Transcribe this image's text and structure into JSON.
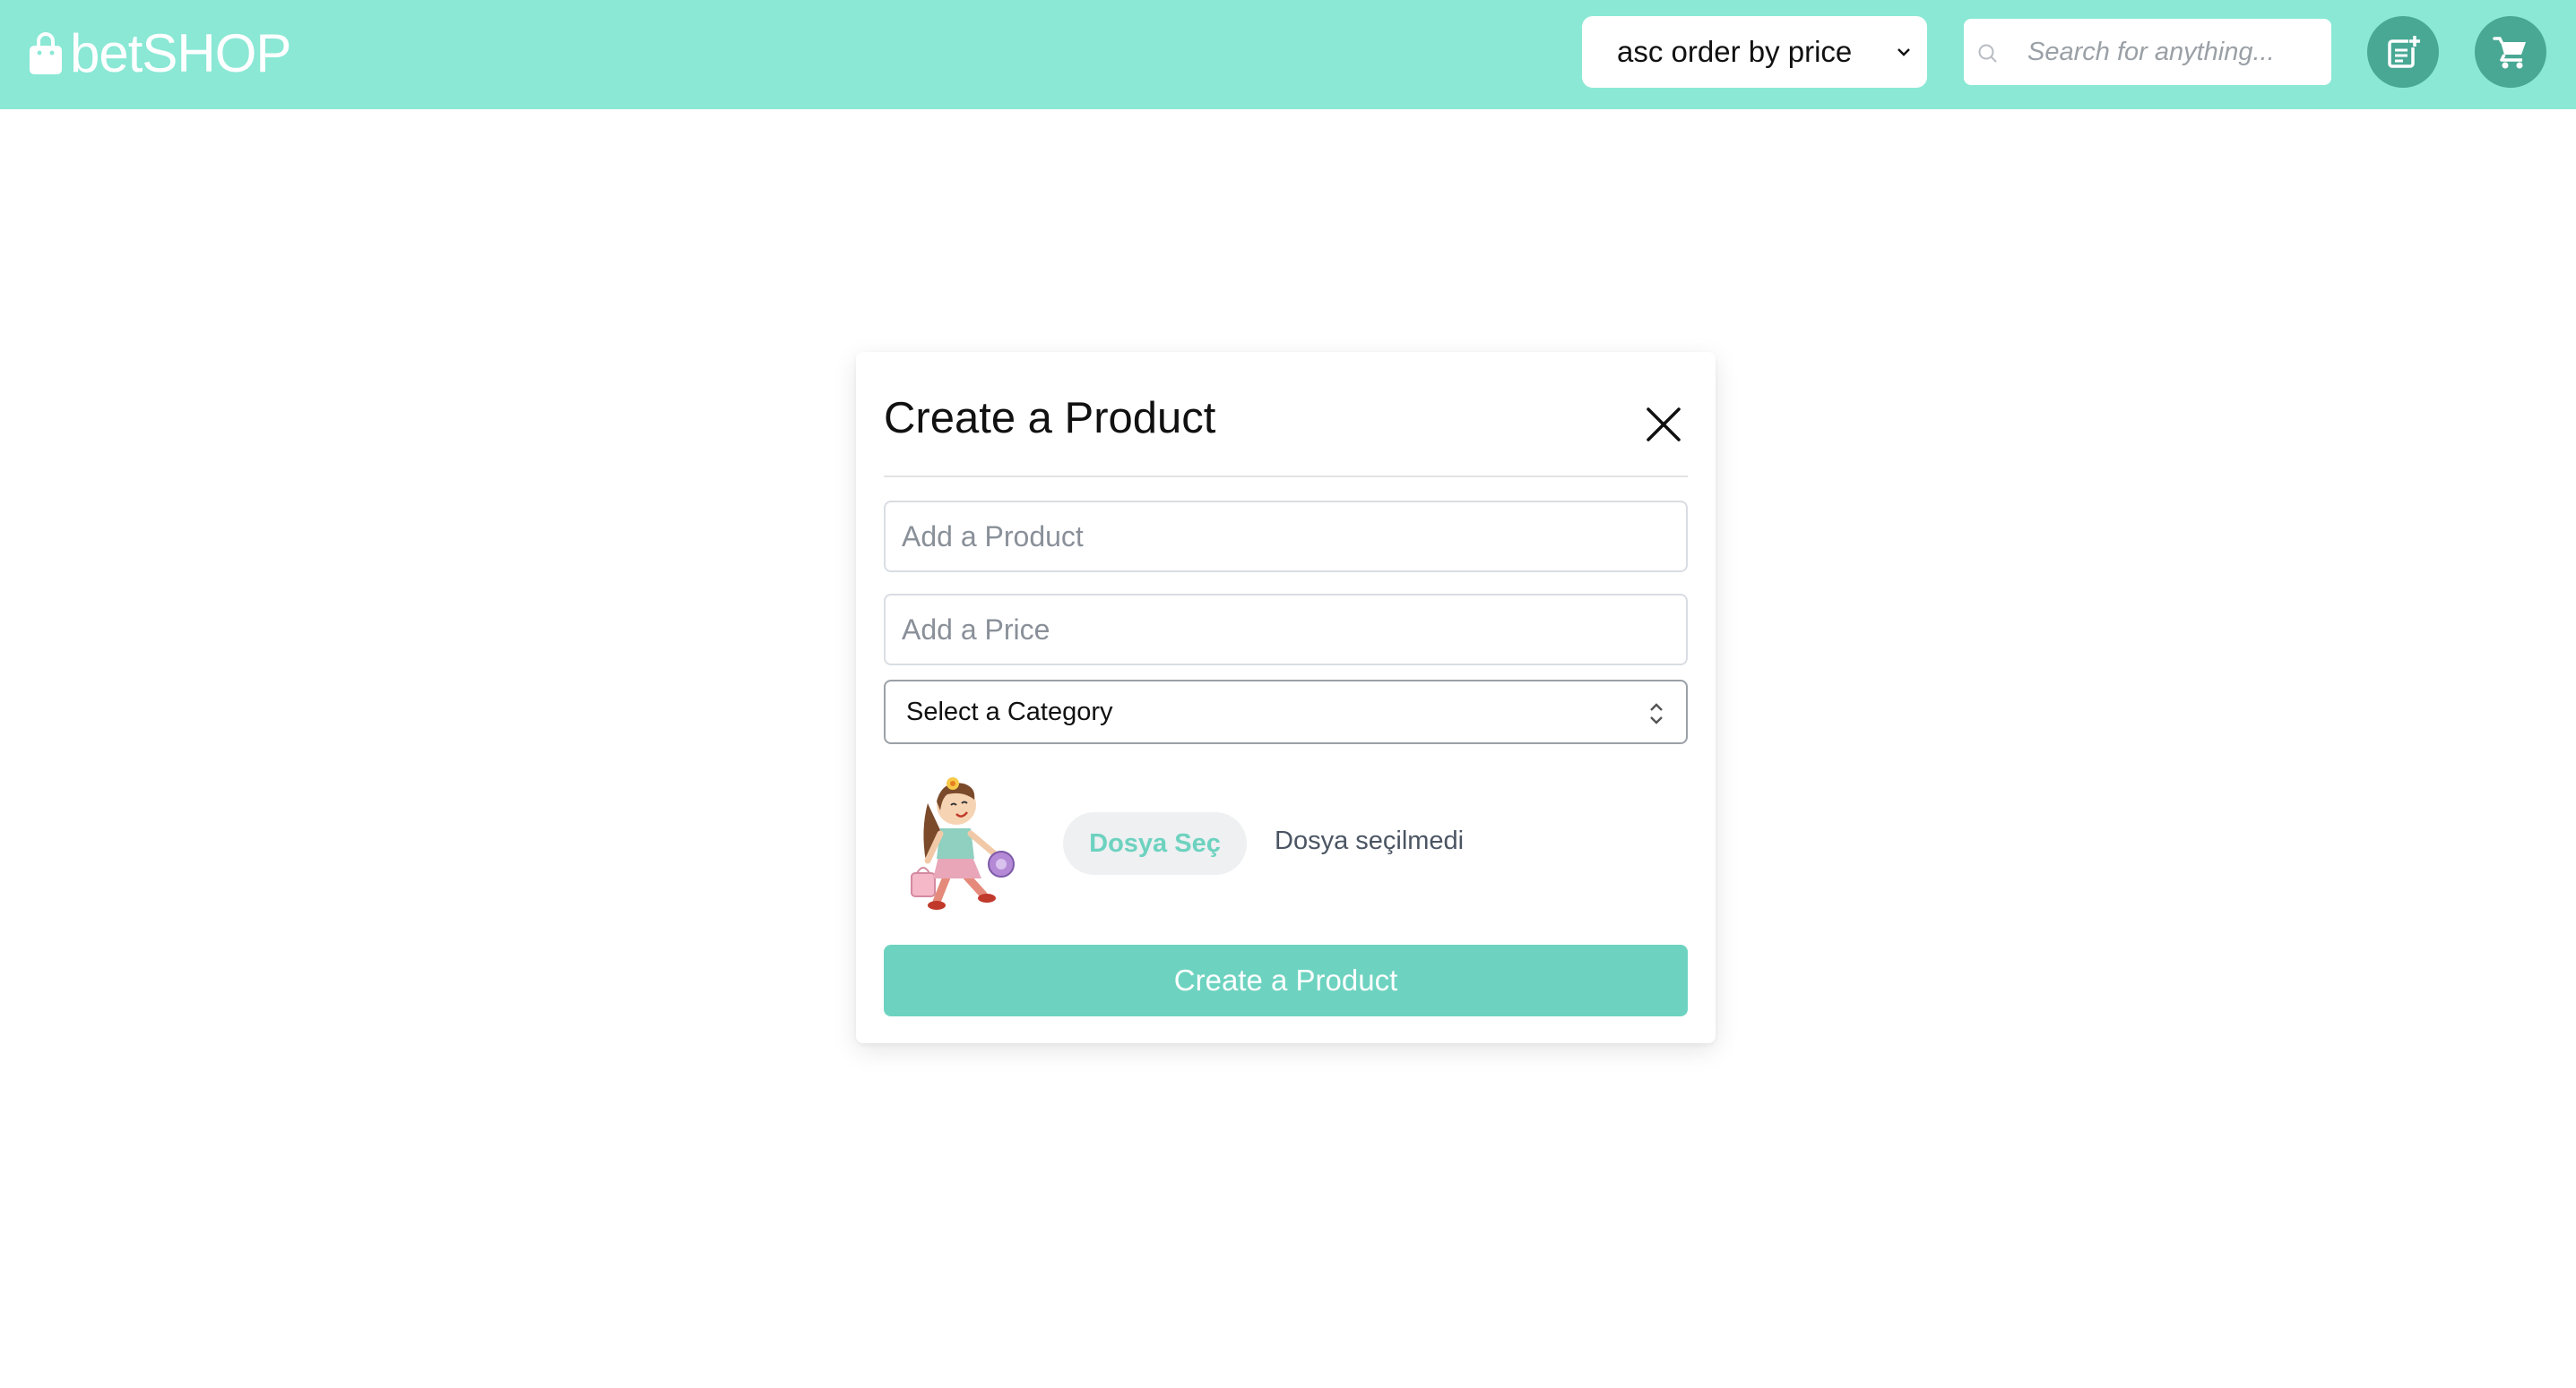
{
  "header": {
    "logo_text": "betSHOP",
    "sort": {
      "selected": "asc order by price"
    },
    "search": {
      "placeholder": "Search for anything..."
    },
    "icons": {
      "logo": "shopping-bag-icon",
      "add": "add-list-icon",
      "cart": "cart-icon",
      "search": "search-icon"
    }
  },
  "modal": {
    "title": "Create a Product",
    "product_placeholder": "Add a Product",
    "price_placeholder": "Add a Price",
    "category_selected": "Select a Category",
    "file_button": "Dosya Seç",
    "file_status": "Dosya seçilmedi",
    "submit_label": "Create a Product"
  },
  "colors": {
    "header_bg": "#8ae8d5",
    "icon_button_bg": "#48a894",
    "accent": "#6dd3c0"
  }
}
